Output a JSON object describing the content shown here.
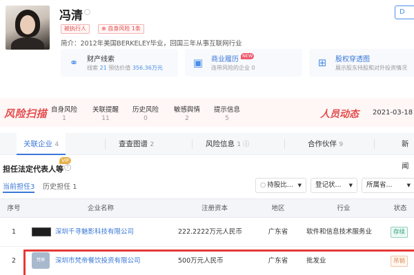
{
  "profile": {
    "name": "冯清",
    "tags": [
      "被执行人",
      "自身风险 1条"
    ],
    "intro": "简介：2012年美国BERKELEY毕业，回国三年从事互联网行业",
    "top_button": "D",
    "cards": [
      {
        "icon": "link-icon",
        "title": "财产线索",
        "sub_prefix": "线索 ",
        "sub_value": "21",
        "sub_middle": "   预估价值 ",
        "sub_value2": "356.36万元"
      },
      {
        "icon": "briefcase-icon",
        "title": "商业履历",
        "badge": "NEW",
        "sub": "连带风险的企业 0"
      },
      {
        "icon": "network-icon",
        "title": "股权穿透图",
        "sub": "展示股东持股和对外投资情况"
      }
    ]
  },
  "risk": {
    "logo": "风险扫描",
    "items": [
      {
        "label": "自身风险",
        "value": "1"
      },
      {
        "label": "关联提醒",
        "value": "11"
      },
      {
        "label": "历史风险",
        "value": "0"
      },
      {
        "label": "敏感舆情",
        "value": "2"
      },
      {
        "label": "提示信息",
        "value": "5"
      }
    ],
    "dynamic_label": "人员动态",
    "dynamic_date": "2021-03-18 "
  },
  "tabs": [
    {
      "label": "关联企业",
      "count": "4"
    },
    {
      "label": "查查图谱",
      "count": "2"
    },
    {
      "label": "风险信息",
      "count": "1"
    },
    {
      "label": "合作伙伴",
      "count": "9"
    },
    {
      "label": "新闻",
      "count": ""
    }
  ],
  "section": {
    "title": "担任法定代表人等",
    "vip": "VIP",
    "subtabs": [
      {
        "label": "当前担任",
        "count": "3"
      },
      {
        "label": "历史担任",
        "count": "1"
      }
    ],
    "filters": [
      "持股比...",
      "登记状...",
      "所属省..."
    ]
  },
  "table": {
    "headers": [
      "序号",
      "企业名称",
      "注册资本",
      "地区",
      "行业",
      "状态"
    ],
    "rows": [
      {
        "no": "1",
        "name": "深圳千寻魅影科技有限公司",
        "capital": "222.2222万元人民币",
        "region": "广东省",
        "industry": "软件和信息技术服务业",
        "status": "存续"
      },
      {
        "no": "2",
        "logo_text": "梵蒂",
        "name": "深圳市梵帝餐饮投资有限公司",
        "capital": "500万元人民币",
        "region": "广东省",
        "industry": "批发业",
        "status": "吊销"
      }
    ]
  },
  "colors": {
    "accent": "#3a78d8",
    "risk": "#e44d4d",
    "highlight": "#e53935"
  }
}
